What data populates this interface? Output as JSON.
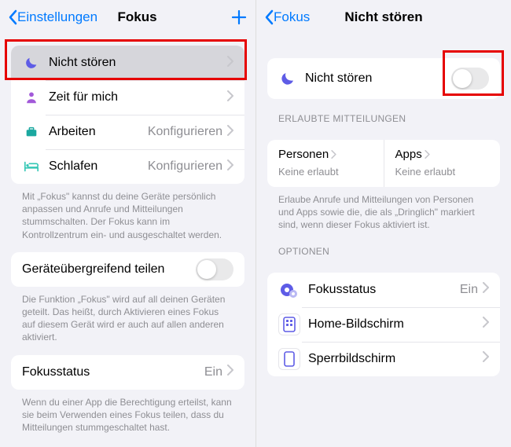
{
  "left": {
    "nav": {
      "back": "Einstellungen",
      "title": "Fokus"
    },
    "modes": [
      {
        "icon": "moon",
        "color": "#5e5ce6",
        "label": "Nicht stören",
        "value": "",
        "selected": true
      },
      {
        "icon": "person",
        "color": "#a259d9",
        "label": "Zeit für mich",
        "value": ""
      },
      {
        "icon": "briefcase",
        "color": "#1ba8a0",
        "label": "Arbeiten",
        "value": "Konfigurieren"
      },
      {
        "icon": "bed",
        "color": "#34c7b5",
        "label": "Schlafen",
        "value": "Konfigurieren"
      }
    ],
    "modes_footer": "Mit „Fokus\" kannst du deine Geräte persönlich anpassen und Anrufe und Mitteilungen stummschalten. Der Fokus kann im Kontrollzentrum ein- und ausgeschaltet werden.",
    "share_row": {
      "label": "Geräteübergreifend teilen"
    },
    "share_footer": "Die Funktion „Fokus\" wird auf all deinen Geräten geteilt. Das heißt, durch Aktivieren eines Fokus auf diesem Gerät wird er auch auf allen anderen aktiviert.",
    "status_row": {
      "label": "Fokusstatus",
      "value": "Ein"
    },
    "status_footer": "Wenn du einer App die Berechtigung erteilst, kann sie beim Verwenden eines Fokus teilen, dass du Mitteilungen stummgeschaltet hast."
  },
  "right": {
    "nav": {
      "back": "Fokus",
      "title": "Nicht stören"
    },
    "hero": {
      "label": "Nicht stören"
    },
    "allowed_header": "ERLAUBTE MITTEILUNGEN",
    "allowed": {
      "persons_label": "Personen",
      "persons_sub": "Keine erlaubt",
      "apps_label": "Apps",
      "apps_sub": "Keine erlaubt"
    },
    "allowed_footer": "Erlaube Anrufe und Mitteilungen von Personen und Apps sowie die, die als „Dringlich\" markiert sind, wenn dieser Fokus aktiviert ist.",
    "options_header": "OPTIONEN",
    "options": [
      {
        "key": "fokusstatus",
        "label": "Fokusstatus",
        "value": "Ein"
      },
      {
        "key": "home",
        "label": "Home-Bildschirm",
        "value": ""
      },
      {
        "key": "lock",
        "label": "Sperrbildschirm",
        "value": ""
      }
    ]
  }
}
